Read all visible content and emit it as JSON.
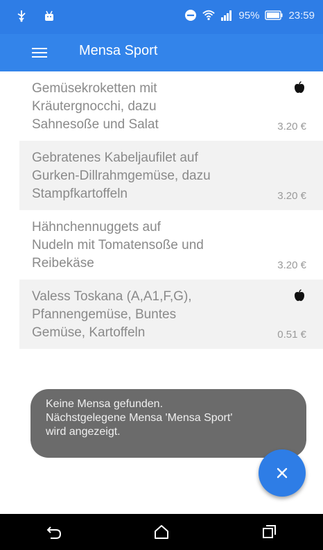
{
  "status_bar": {
    "battery": "95%",
    "time": "23:59",
    "icons": [
      "usb-icon",
      "android-icon",
      "do-not-disturb-icon",
      "wifi-icon",
      "signal-icon",
      "battery-icon"
    ]
  },
  "app_bar": {
    "title": "Mensa Sport",
    "menu_icon": "hamburger-menu-icon"
  },
  "menu": [
    {
      "name": "Gemüsekroketten mit\nKräutergnocchi, dazu\nSahnesoße und Salat",
      "price": "3.20 €",
      "vegetarian": true
    },
    {
      "name": "Gebratenes Kabeljaufilet auf\nGurken-Dillrahmgemüse, dazu\nStampfkartoffeln",
      "price": "3.20 €",
      "vegetarian": false
    },
    {
      "name": "Hähnchennuggets auf\nNudeln mit Tomatensoße und\nReibekäse",
      "price": "3.20 €",
      "vegetarian": false
    },
    {
      "name": "Valess Toskana (A,A1,F,G),\nPfannengemüse, Buntes\nGemüse, Kartoffeln",
      "price": "0.51 €",
      "vegetarian": true
    }
  ],
  "snackbar": {
    "line1": "Keine Mensa gefunden.",
    "line2": "Nächstgelegene Mensa 'Mensa Sport'",
    "line3": "wird angezeigt."
  },
  "fab": {
    "icon": "close-icon"
  },
  "nav_bar": {
    "icons": [
      "back-icon",
      "home-icon",
      "recents-icon"
    ]
  },
  "colors": {
    "primary": "#3384ea",
    "status_bar": "#2e7de6",
    "snackbar": "#6b6b6b"
  }
}
